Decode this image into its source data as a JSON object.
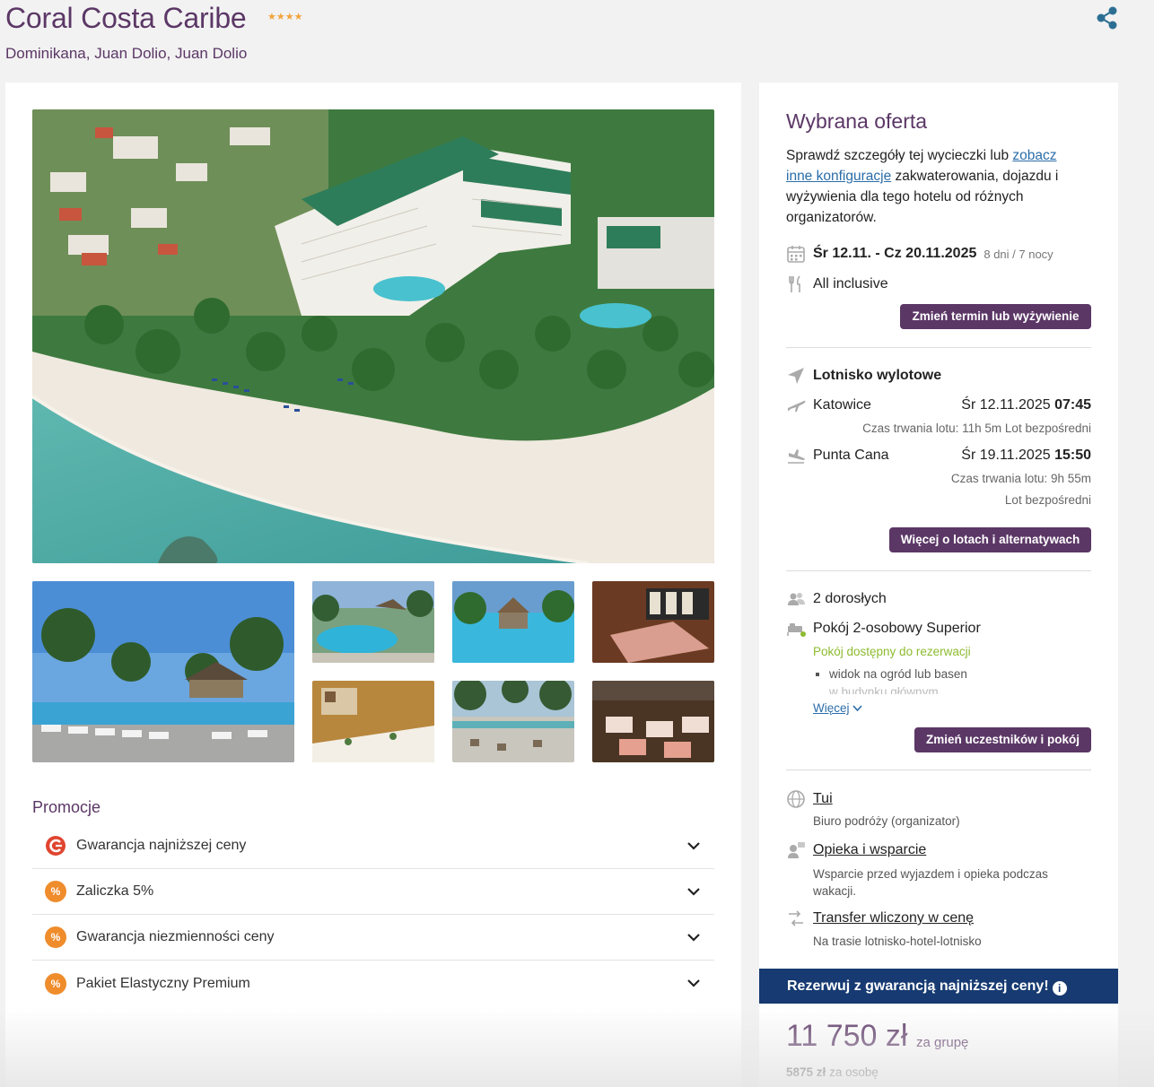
{
  "header": {
    "title": "Coral Costa Caribe",
    "stars": "★★★★",
    "location": "Dominikana, Juan Dolio, Juan Dolio",
    "share_icon": "share-icon"
  },
  "promotions": {
    "title": "Promocje",
    "items": [
      {
        "label": "Gwarancja najniższej ceny",
        "icon": "lowest-price-guarantee-icon"
      },
      {
        "label": "Zaliczka 5%",
        "icon": "percent-icon"
      },
      {
        "label": "Gwarancja niezmienności ceny",
        "icon": "percent-icon"
      },
      {
        "label": "Pakiet Elastyczny Premium",
        "icon": "percent-icon"
      }
    ]
  },
  "offer": {
    "title": "Wybrana oferta",
    "desc_before": "Sprawdź szczegóły tej wycieczki lub ",
    "desc_link": "zobacz inne konfiguracje",
    "desc_after": " zakwaterowania, dojazdu i wyżywienia dla tego hotelu od różnych organizatorów.",
    "dates": "Śr 12.11. - Cz 20.11.2025",
    "duration": "8 dni / 7 nocy",
    "board": "All inclusive",
    "change_date_button": "Zmień termin lub wyżywienie"
  },
  "flights": {
    "heading": "Lotnisko wylotowe",
    "outbound": {
      "city": "Katowice",
      "date": "Śr 12.11.2025",
      "time": "07:45",
      "info": "Czas trwania lotu: 11h 5m",
      "type": "Lot bezpośredni"
    },
    "return": {
      "city": "Punta Cana",
      "date": "Śr 19.11.2025",
      "time": "15:50",
      "info": "Czas trwania lotu: 9h 55m",
      "type": "Lot bezpośredni"
    },
    "more_button": "Więcej o lotach i alternatywach"
  },
  "room": {
    "participants": "2 dorosłych",
    "room_type": "Pokój 2-osobowy Superior",
    "availability": "Pokój dostępny do rezerwacji",
    "features": [
      "widok na ogród lub basen",
      "w budynku głównym"
    ],
    "more_link": "Więcej",
    "change_button": "Zmień uczestników i pokój"
  },
  "organizer": {
    "name": "Tui",
    "name_desc": "Biuro podróży (organizator)",
    "support": "Opieka i wsparcie",
    "support_desc": "Wsparcie przed wyjazdem i opieka podczas wakacji.",
    "transfer": "Transfer wliczony w cenę",
    "transfer_desc": "Na trasie lotnisko-hotel-lotnisko"
  },
  "booking": {
    "guarantee": "Rezerwuj z gwarancją najniższej ceny!",
    "price": "11 750 zł",
    "price_unit": "za grupę",
    "per_person_value": "5875 zł",
    "per_person_label": "za osobę"
  },
  "colors": {
    "brand_purple": "#5b3766",
    "link_blue": "#2b6da8",
    "guarantee_navy": "#163a71",
    "available_green": "#8dbb2f",
    "promo_orange": "#ef8c2c"
  }
}
